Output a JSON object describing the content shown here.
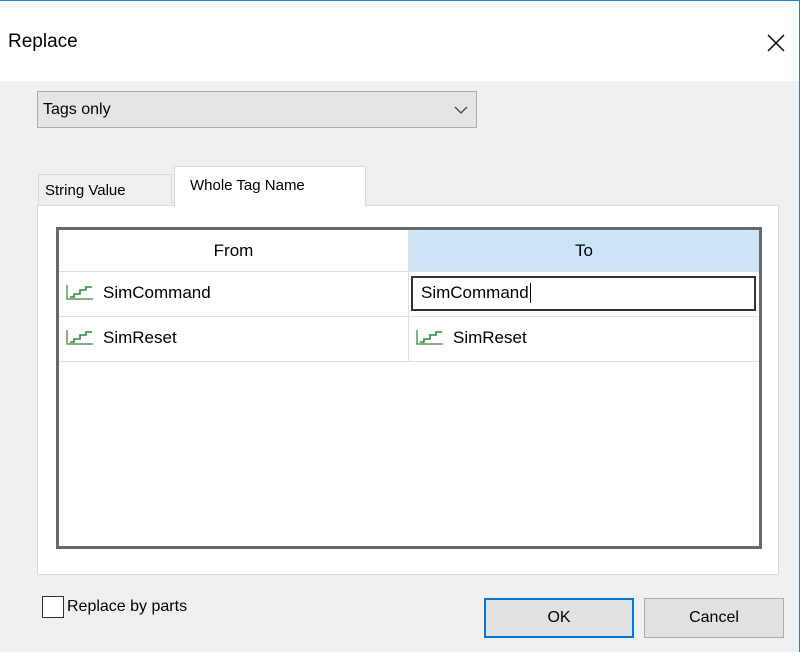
{
  "dialog": {
    "title": "Replace"
  },
  "scope_select": {
    "value": "Tags only"
  },
  "tabs": [
    {
      "label": "String Value"
    },
    {
      "label": "Whole Tag Name"
    }
  ],
  "table": {
    "columns": [
      "From",
      "To"
    ],
    "rows": [
      {
        "from": "SimCommand",
        "to": "SimCommand"
      },
      {
        "from": "SimReset",
        "to": "SimReset"
      }
    ]
  },
  "options": {
    "replace_by_parts_label": "Replace by parts",
    "replace_by_parts_checked": false
  },
  "buttons": {
    "ok": "OK",
    "cancel": "Cancel"
  },
  "colors": {
    "accent": "#0078d7",
    "selected_header": "#cce4f7",
    "tag_icon": "#2e8b3a"
  }
}
